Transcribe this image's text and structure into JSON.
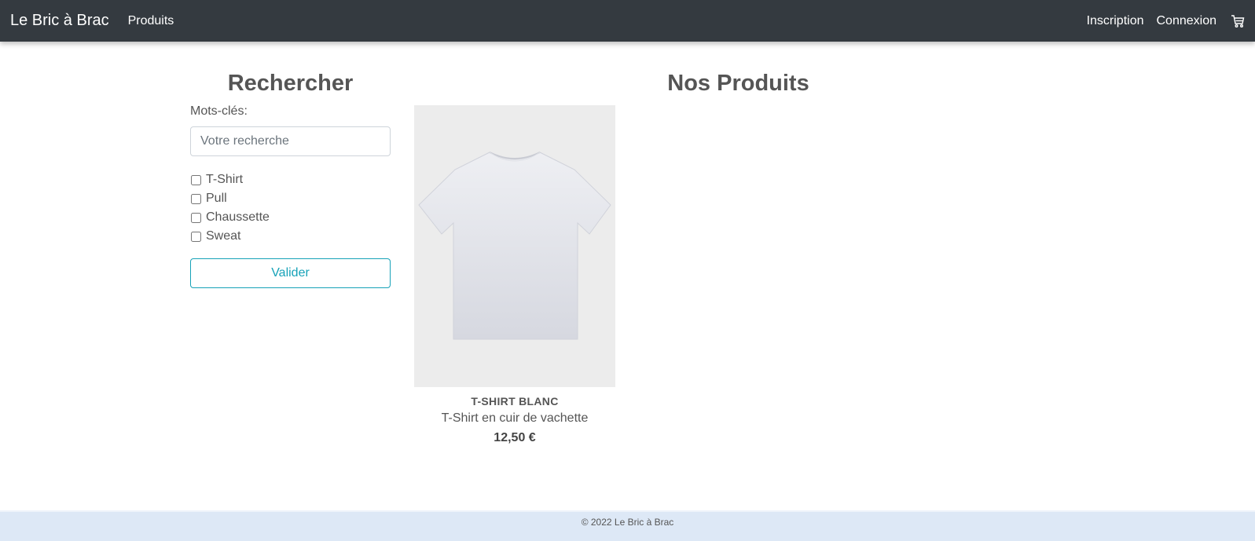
{
  "navbar": {
    "brand": "Le Bric à Brac",
    "products_link": "Produits",
    "register_link": "Inscription",
    "login_link": "Connexion",
    "cart_icon": "cart-icon"
  },
  "search": {
    "title": "Rechercher",
    "keywords_label": "Mots-clés:",
    "placeholder": "Votre recherche",
    "value": "",
    "categories": [
      {
        "label": "T-Shirt",
        "checked": false
      },
      {
        "label": "Pull",
        "checked": false
      },
      {
        "label": "Chaussette",
        "checked": false
      },
      {
        "label": "Sweat",
        "checked": false
      }
    ],
    "submit_label": "Valider"
  },
  "products": {
    "title": "Nos Produits",
    "items": [
      {
        "name": "T-SHIRT BLANC",
        "description": "T-Shirt en cuir de vachette",
        "price": "12,50 €"
      }
    ]
  },
  "footer": {
    "text": "© 2022 Le Bric à Brac"
  },
  "colors": {
    "navbar_bg": "#343a40",
    "accent": "#17a2b8",
    "footer_bg": "#dde8f6"
  }
}
